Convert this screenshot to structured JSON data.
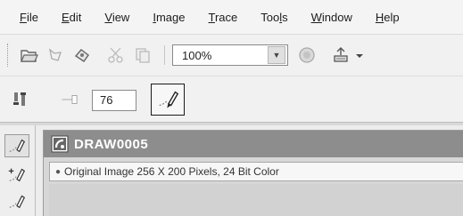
{
  "menu": [
    {
      "label": "File",
      "mnemonic": "F",
      "rest": "ile"
    },
    {
      "label": "Edit",
      "mnemonic": "E",
      "rest": "dit"
    },
    {
      "label": "View",
      "mnemonic": "V",
      "rest": "iew"
    },
    {
      "label": "Image",
      "mnemonic": "I",
      "rest": "mage"
    },
    {
      "label": "Trace",
      "mnemonic": "T",
      "rest": "race"
    },
    {
      "label": "Tools",
      "pre": "Too",
      "mnemonic": "l",
      "rest": "s"
    },
    {
      "label": "Window",
      "mnemonic": "W",
      "rest": "indow"
    },
    {
      "label": "Help",
      "mnemonic": "H",
      "rest": "elp"
    }
  ],
  "toolbar": {
    "zoom_value": "100%",
    "icons": [
      "open-icon",
      "hand-icon",
      "stamp-icon",
      "cut-icon",
      "copy-icon",
      "globe-icon",
      "scanner-icon",
      "chevron-down-icon"
    ]
  },
  "property_bar": {
    "value": "76"
  },
  "document": {
    "title": "DRAW0005",
    "info": "Original Image   256 X 200 Pixels, 24 Bit Color"
  }
}
